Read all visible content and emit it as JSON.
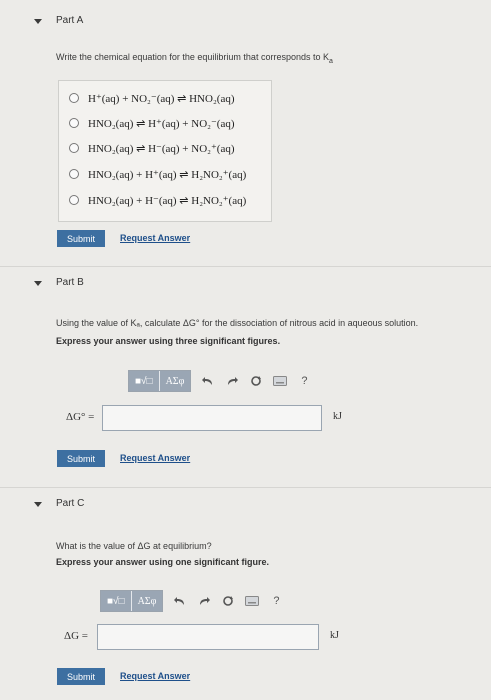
{
  "partA": {
    "title": "Part A",
    "prompt": "Write the chemical equation for the equilibrium that corresponds to K",
    "prompt_sub": "a",
    "choices": [
      "H⁺(aq) + NO₂⁻(aq) ⇌ HNO₂(aq)",
      "HNO₂(aq) ⇌ H⁺(aq) + NO₂⁻(aq)",
      "HNO₂(aq) ⇌ H⁻(aq) + NO₂⁺(aq)",
      "HNO₂(aq) + H⁺(aq) ⇌ H₂NO₂⁺(aq)",
      "HNO₂(aq) + H⁻(aq) ⇌ H₂NO₂⁺(aq)"
    ],
    "submit": "Submit",
    "request": "Request Answer"
  },
  "partB": {
    "title": "Part B",
    "prompt": "Using the value of Kₐ, calculate ΔG° for the dissociation of nitrous acid in aqueous solution.",
    "instruction": "Express your answer using three significant figures.",
    "label": "ΔG° =",
    "value": "",
    "unit": "kJ",
    "submit": "Submit",
    "request": "Request Answer"
  },
  "partC": {
    "title": "Part C",
    "prompt": "What is the value of ΔG at equilibrium?",
    "instruction": "Express your answer using one significant figure.",
    "label": "ΔG =",
    "value": "",
    "unit": "kJ",
    "submit": "Submit",
    "request": "Request Answer"
  },
  "toolbar": {
    "template_label": "■√□",
    "greek_label": "ΑΣφ",
    "icons": [
      "undo-icon",
      "redo-icon",
      "reset-icon",
      "keyboard-icon",
      "help-icon"
    ],
    "help_glyph": "?"
  },
  "colors": {
    "submit_bg": "#3d6fa1",
    "link": "#1e4f8a",
    "toolbar_bg": "#9aa6b4"
  }
}
